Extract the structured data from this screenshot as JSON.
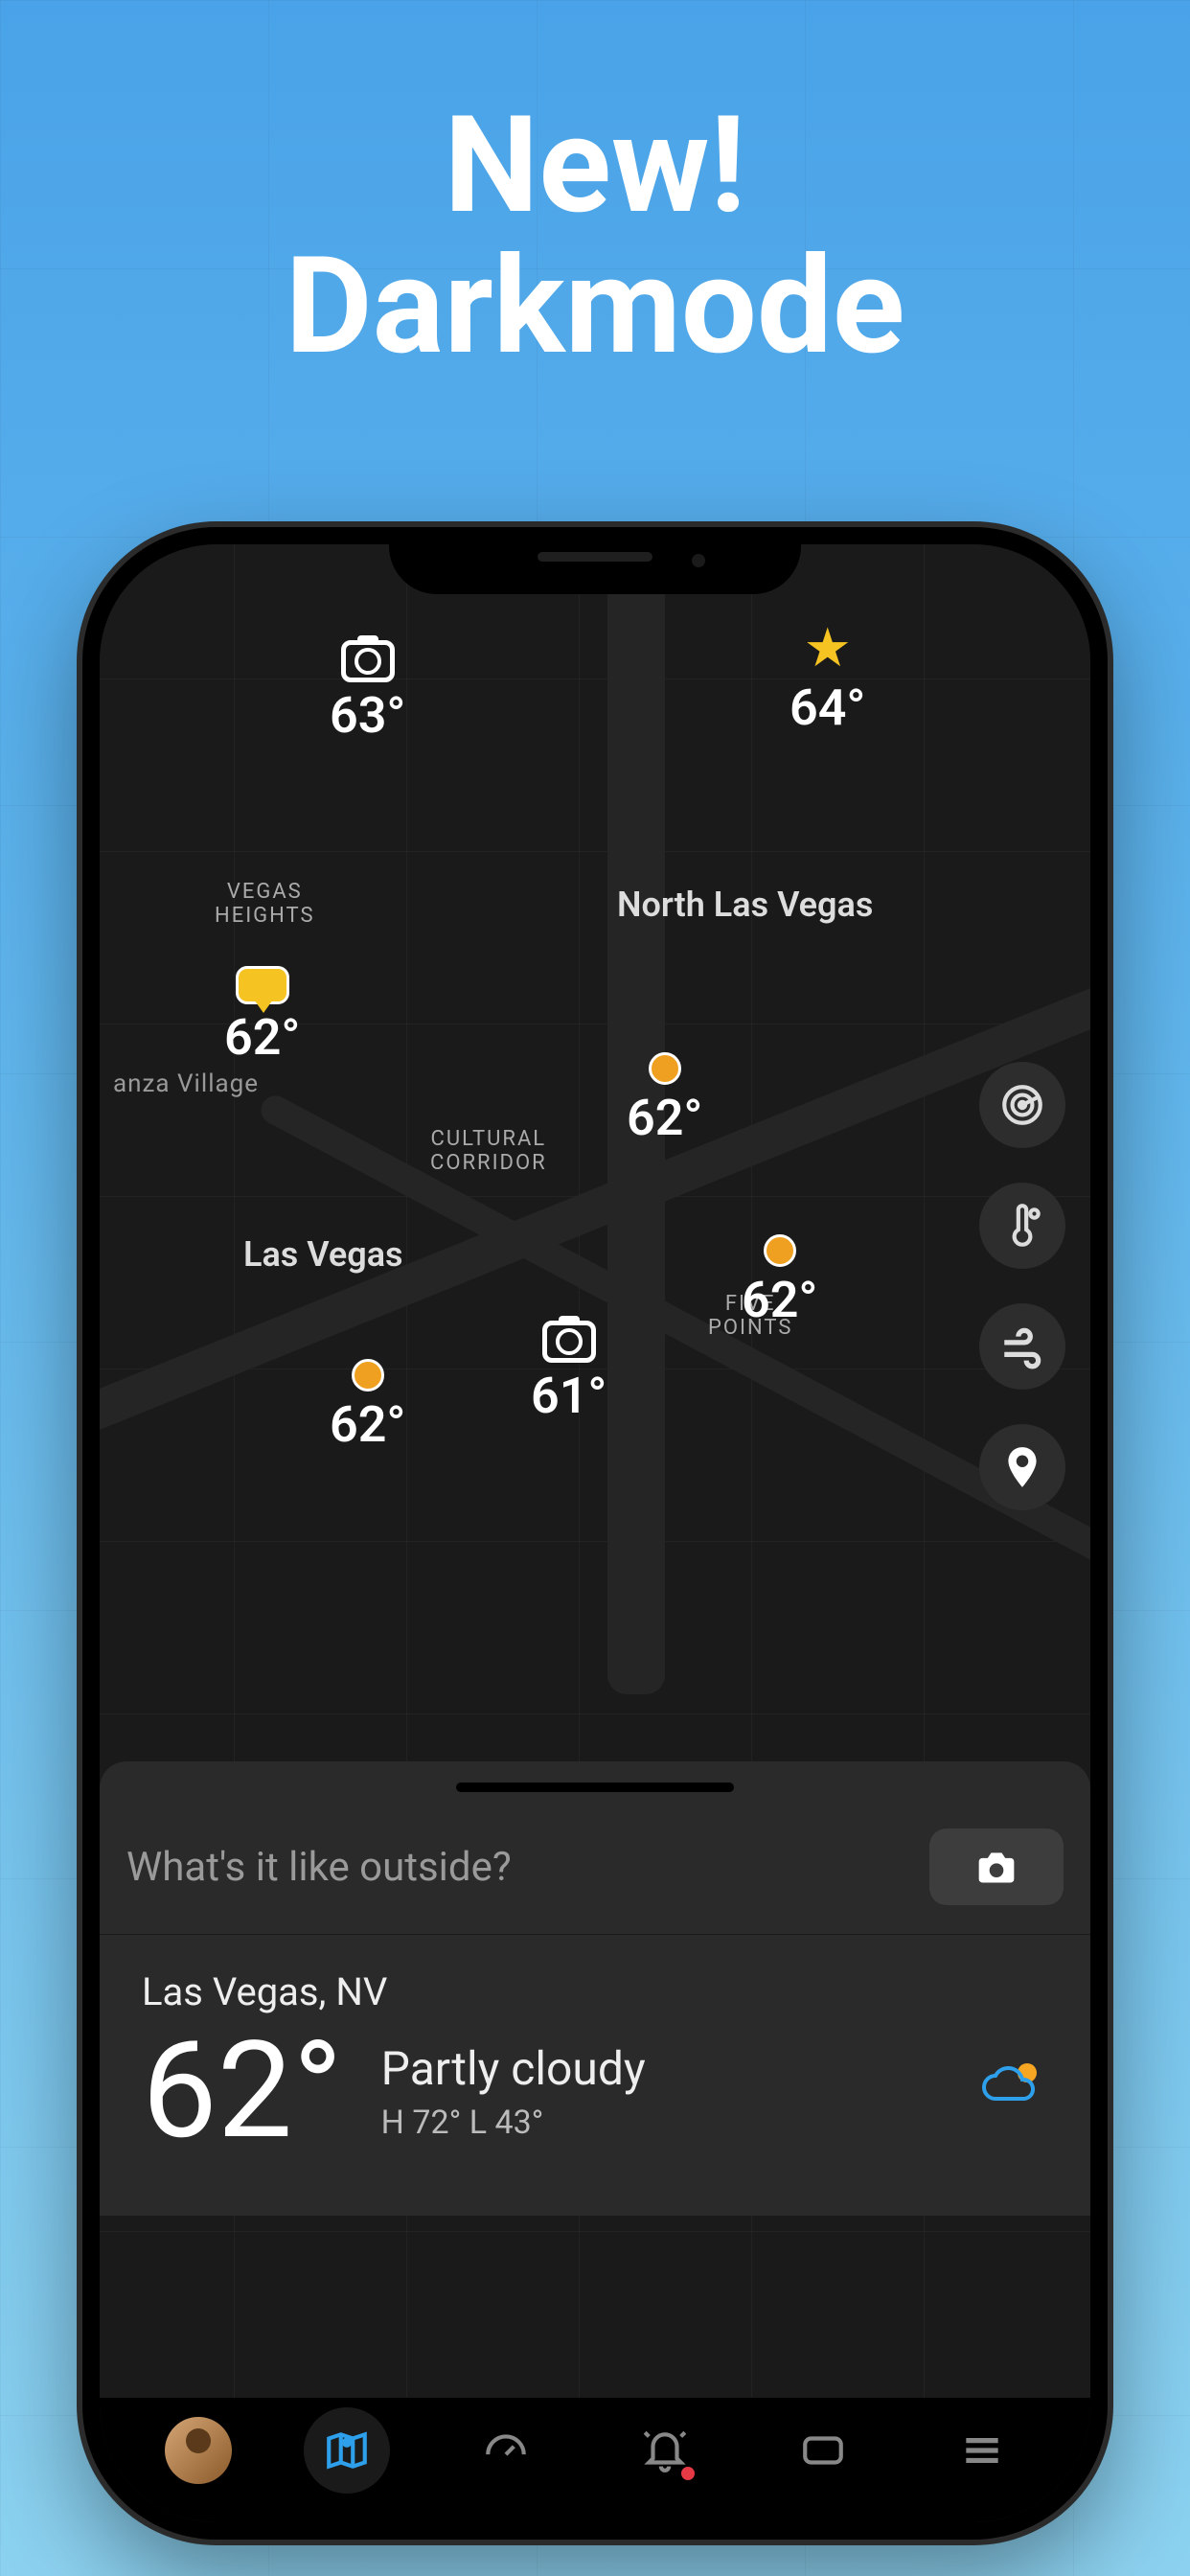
{
  "promo": {
    "line1": "New!",
    "line2": "Darkmode"
  },
  "map_labels": {
    "vegas_heights": "VEGAS\nHEIGHTS",
    "north_las_vegas": "North Las Vegas",
    "anza_village": "anza Village",
    "cultural_corridor": "CULTURAL\nCORRIDOR",
    "las_vegas": "Las Vegas",
    "five_points": "FIVE\nPOINTS"
  },
  "pins": {
    "p1": {
      "temp": "63°"
    },
    "p2": {
      "temp": "64°"
    },
    "p3": {
      "temp": "62°"
    },
    "p4": {
      "temp": "62°"
    },
    "p5": {
      "temp": "62°"
    },
    "p6": {
      "temp": "62°"
    },
    "p7": {
      "temp": "61°"
    }
  },
  "input": {
    "placeholder": "What's it like outside?"
  },
  "weather": {
    "location": "Las Vegas, NV",
    "temp": "62°",
    "condition": "Partly cloudy",
    "hilo": "H 72°   L 43°"
  },
  "side": {
    "radar": "radar-icon",
    "therm": "thermometer-icon",
    "wind": "wind-icon",
    "loc": "location-icon"
  }
}
